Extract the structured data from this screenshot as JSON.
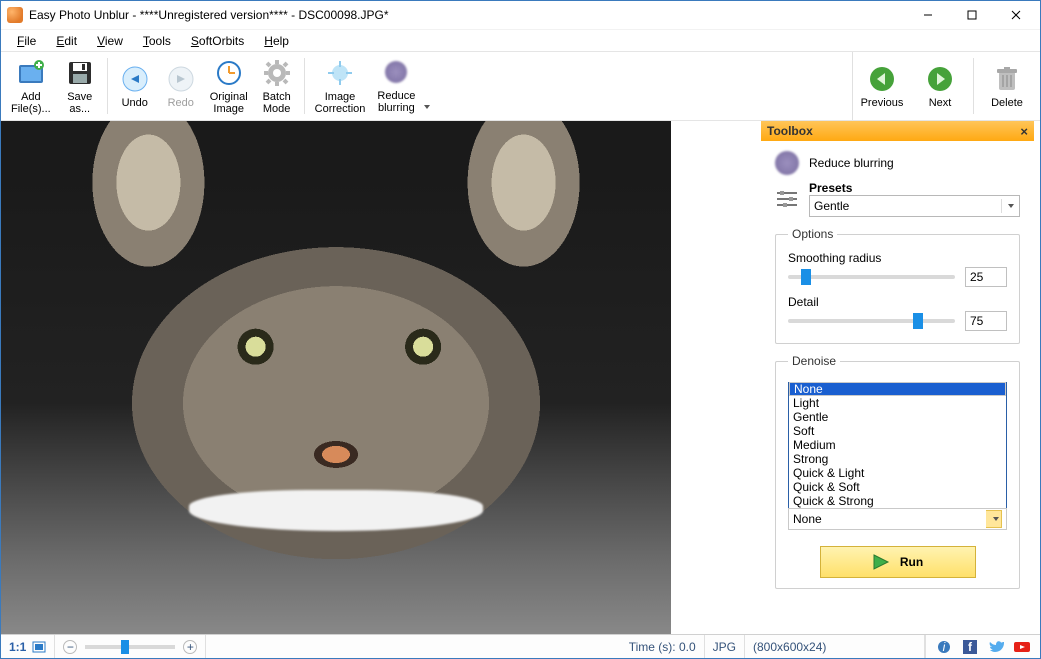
{
  "title": "Easy Photo Unblur - ****Unregistered version**** - DSC00098.JPG*",
  "menu": {
    "file": "File",
    "edit": "Edit",
    "view": "View",
    "tools": "Tools",
    "softorbits": "SoftOrbits",
    "help": "Help"
  },
  "toolbar": {
    "add_files": "Add\nFile(s)...",
    "save_as": "Save\nas...",
    "undo": "Undo",
    "redo": "Redo",
    "original_image": "Original\nImage",
    "batch_mode": "Batch\nMode",
    "image_correction": "Image\nCorrection",
    "reduce_blurring": "Reduce\nblurring",
    "previous": "Previous",
    "next": "Next",
    "delete": "Delete"
  },
  "toolbox": {
    "title": "Toolbox",
    "mode_label": "Reduce blurring",
    "presets_label": "Presets",
    "preset_value": "Gentle",
    "options_legend": "Options",
    "smoothing_label": "Smoothing radius",
    "smoothing_value": "25",
    "smoothing_pct": 8,
    "detail_label": "Detail",
    "detail_value": "75",
    "detail_pct": 75,
    "denoise_legend": "Denoise",
    "denoise_items": [
      "None",
      "Light",
      "Gentle",
      "Soft",
      "Medium",
      "Strong",
      "Quick & Light",
      "Quick & Soft",
      "Quick & Strong"
    ],
    "denoise_selected": "None",
    "denoise_combo_value": "None",
    "run": "Run"
  },
  "status": {
    "ratio": "1:1",
    "time": "Time (s): 0.0",
    "format": "JPG",
    "dims": "(800x600x24)"
  }
}
